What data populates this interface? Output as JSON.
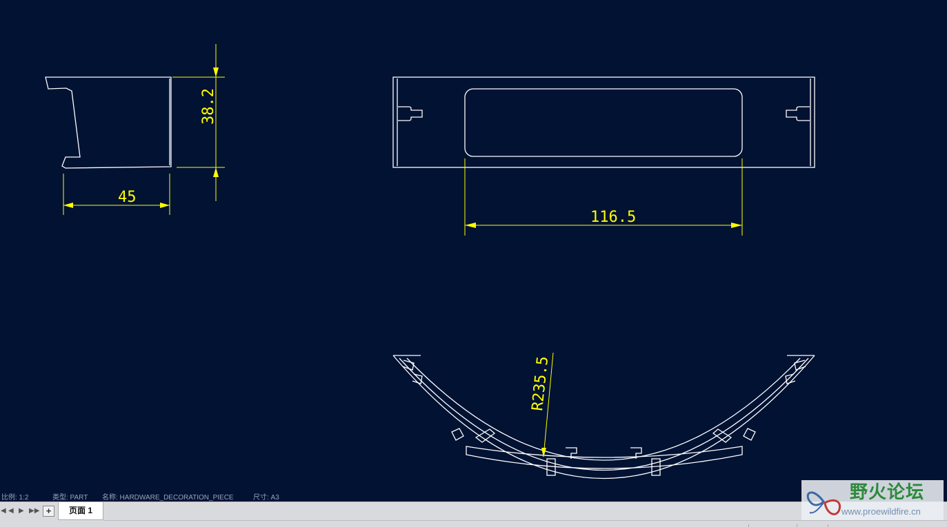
{
  "colors": {
    "background": "#011233",
    "geometry": "#ffffff",
    "dimension": "#ffff00",
    "tabbar": "#d9dadd"
  },
  "drawing": {
    "dimensions": {
      "side_view_height": "38.2",
      "side_view_width": "45",
      "front_view_width": "116.5",
      "top_view_radius": "R235.5"
    }
  },
  "status": {
    "scale": "比例: 1:2",
    "type": "类型: PART",
    "name": "名称: HARDWARE_DECORATION_PIECE",
    "size": "尺寸: A3"
  },
  "tabbar": {
    "nav_icons": [
      "first-page-icon",
      "prev-page-icon",
      "next-page-icon",
      "last-page-icon"
    ],
    "add_page_label": "+",
    "page_tab_label": "页面 1"
  },
  "watermark": {
    "title": "野火论坛",
    "url": "www.proewildfire.cn"
  }
}
